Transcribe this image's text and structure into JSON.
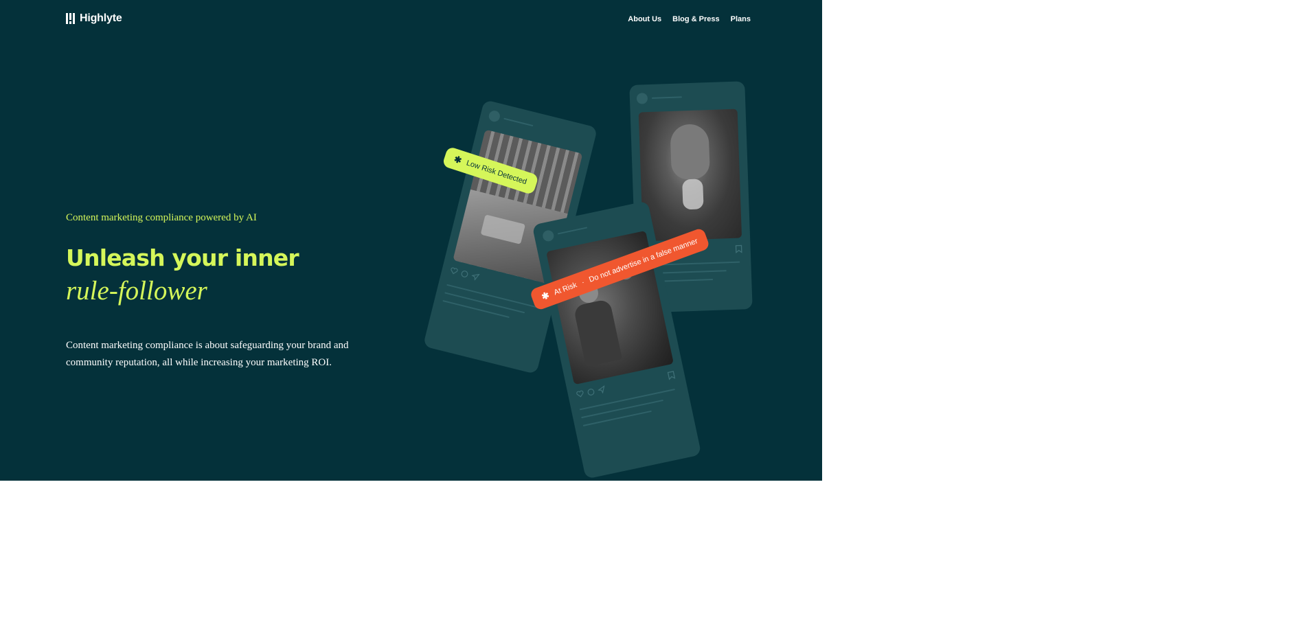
{
  "header": {
    "logo_text": "Highlyte",
    "nav": [
      {
        "label": "About Us"
      },
      {
        "label": "Blog & Press"
      },
      {
        "label": "Plans"
      }
    ]
  },
  "hero": {
    "eyebrow": "Content marketing compliance powered by AI",
    "headline_line1": "Unleash your inner",
    "headline_line2": "rule-follower",
    "description": "Content marketing compliance is about safeguarding your brand and community reputation, all while increasing your marketing ROI."
  },
  "cards": {
    "low_risk_tag": {
      "icon": "asterisk-icon",
      "label": "Low Risk Detected"
    },
    "at_risk_tag": {
      "icon": "asterisk-icon",
      "label": "At Risk",
      "separator": "·",
      "reason": "Do not advertise in a false manner"
    }
  },
  "colors": {
    "background": "#04313a",
    "accent": "#d5f65a",
    "card": "#1d4c52",
    "risk": "#f0572f"
  }
}
